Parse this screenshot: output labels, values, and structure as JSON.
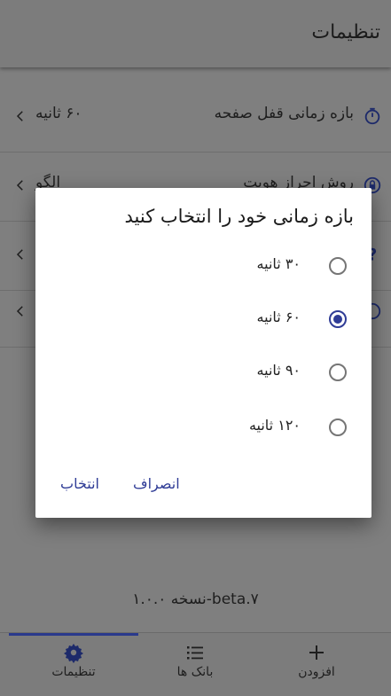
{
  "app_bar": {
    "title": "تنظیمات"
  },
  "settings": [
    {
      "label": "بازه زمانی قفل صفحه",
      "value": "۶۰ ثانیه",
      "icon": "timer-icon"
    },
    {
      "label": "روش احراز هویت",
      "value": "الگو",
      "icon": "lock-icon"
    },
    {
      "label": "",
      "value": "",
      "icon": "help-icon"
    },
    {
      "label": "",
      "value": "",
      "icon": "info-icon"
    }
  ],
  "version": {
    "label": "نسخه",
    "value": "1.0.0-beta.7"
  },
  "version_text": "نسخه  ۱.۰.۰-beta.۷",
  "nav": {
    "items": [
      {
        "label": "تنظیمات",
        "icon": "gear-icon",
        "active": true
      },
      {
        "label": "بانک ها",
        "icon": "list-icon",
        "active": false
      },
      {
        "label": "افزودن",
        "icon": "plus-icon",
        "active": false
      }
    ]
  },
  "dialog": {
    "title": "بازه زمانی خود را انتخاب کنید",
    "options": [
      {
        "label": "۳۰ ثانیه",
        "selected": false
      },
      {
        "label": "۶۰ ثانیه",
        "selected": true
      },
      {
        "label": "۹۰ ثانیه",
        "selected": false
      },
      {
        "label": "۱۲۰ ثانیه",
        "selected": false
      }
    ],
    "cancel_label": "انصراف",
    "select_label": "انتخاب"
  },
  "colors": {
    "accent": "#2f3c96",
    "scrim": "#7f7f7f"
  }
}
